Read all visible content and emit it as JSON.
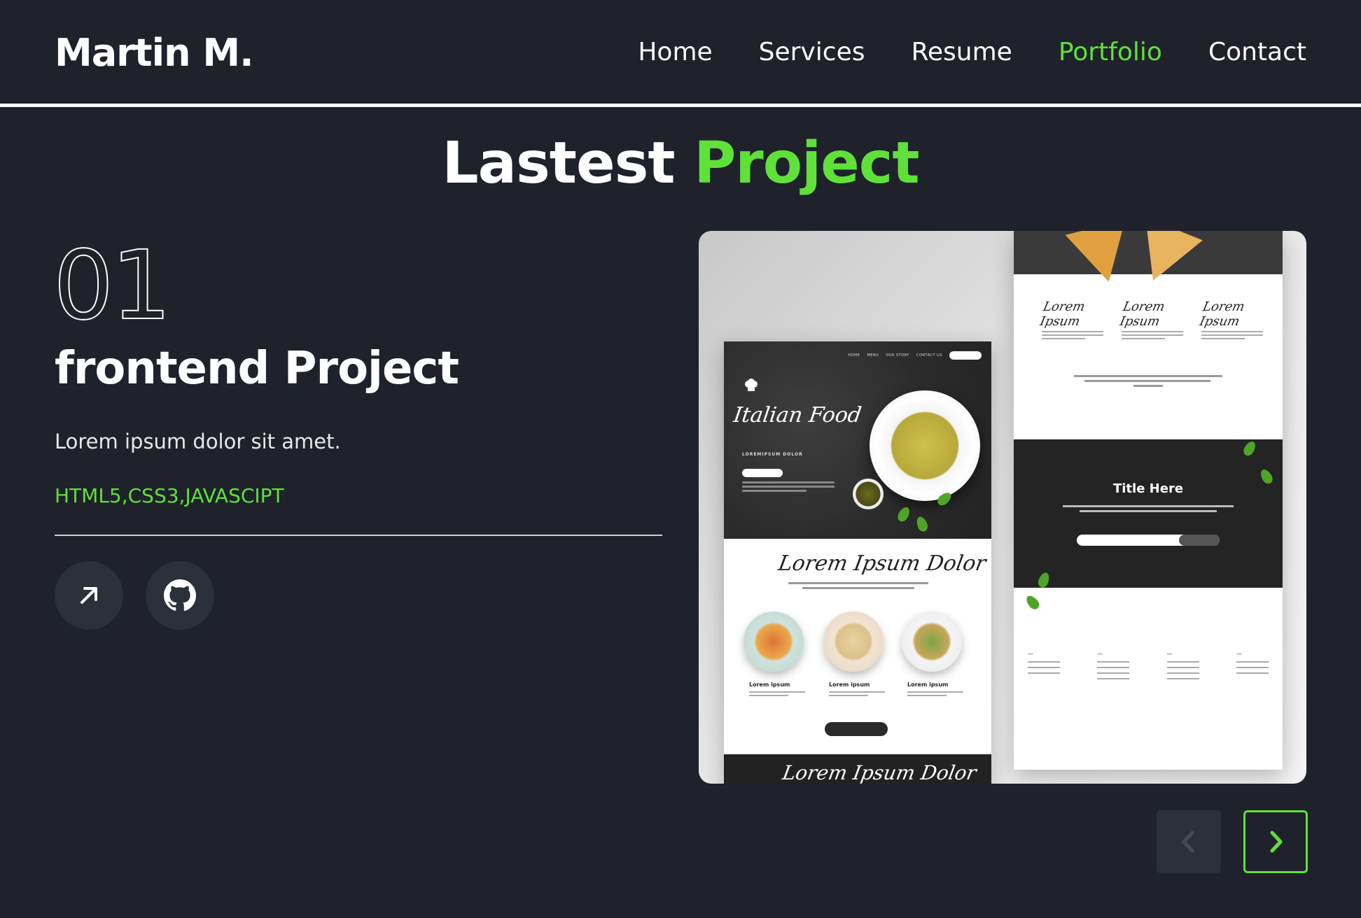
{
  "header": {
    "logo": "Martin M.",
    "nav": [
      {
        "label": "Home",
        "active": false
      },
      {
        "label": "Services",
        "active": false
      },
      {
        "label": "Resume",
        "active": false
      },
      {
        "label": "Portfolio",
        "active": true
      },
      {
        "label": "Contact",
        "active": false
      }
    ]
  },
  "section": {
    "title_main": "Lastest",
    "title_accent": "Project"
  },
  "project": {
    "number": "01",
    "title": "frontend Project",
    "description": "Lorem ipsum dolor sit amet.",
    "tech": "HTML5,CSS3,JAVASCIPT",
    "live_icon": "arrow-up-right-icon",
    "github_icon": "github-icon"
  },
  "preview": {
    "left_script": "Italian Food",
    "left_sub": "LOREMIPSUM DOLOR",
    "body_script": "Lorem Ipsum Dolor",
    "dish_caption": "Lorem ipsum",
    "footer_script": "Lorem Ipsum Dolor",
    "right_band_title": "Title Here",
    "right_sig": "Lorem Ipsum"
  },
  "slider": {
    "prev_icon": "chevron-left-icon",
    "next_icon": "chevron-right-icon"
  },
  "colors": {
    "background": "#1f222b",
    "accent": "#5fe13a",
    "button_bg": "#2c303b"
  }
}
